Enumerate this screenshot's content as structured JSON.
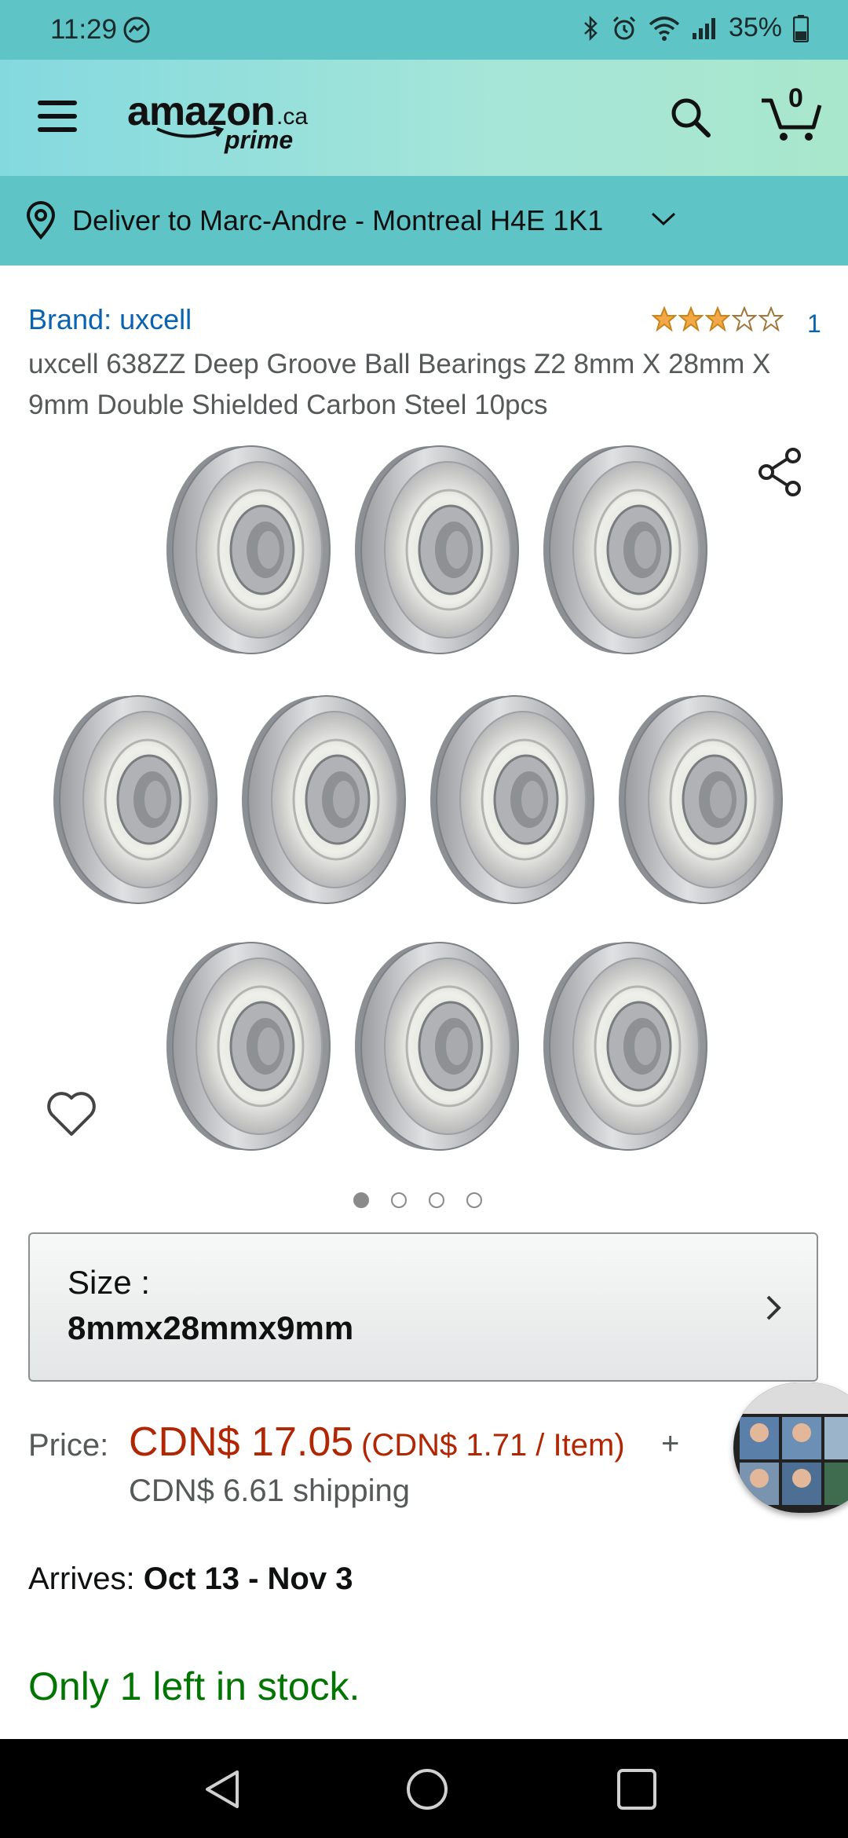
{
  "status_bar": {
    "time": "11:29",
    "battery": "35%"
  },
  "header": {
    "logo_word": "amazon",
    "logo_ca": ".ca",
    "logo_prime": "prime",
    "cart_count": "0"
  },
  "deliver": {
    "text": "Deliver to Marc-Andre - Montreal H4E 1K1"
  },
  "product": {
    "brand": "Brand: uxcell",
    "rating_count": "1",
    "rating_stars": 3,
    "title": "uxcell 638ZZ Deep Groove Ball Bearings Z2 8mm X 28mm X 9mm Double Shielded Carbon Steel 10pcs",
    "image_count": 4,
    "image_index": 1
  },
  "size": {
    "label": "Size :",
    "value": "8mmx28mmx9mm"
  },
  "price": {
    "label": "Price:",
    "main": "CDN$ 17.05",
    "unit": "(CDN$ 1.71 / Item)",
    "plus": "+",
    "shipping": "CDN$ 6.61 shipping"
  },
  "arrives": {
    "label": "Arrives:",
    "date": "Oct 13 - Nov 3"
  },
  "stock": "Only 1 left in stock.",
  "colors": {
    "status_bar": "#5fc4c6",
    "deliver_bar": "#5fc4c6",
    "link": "#0a63b1",
    "price": "#b12704",
    "stock": "#007600",
    "star": "#f3a847"
  }
}
